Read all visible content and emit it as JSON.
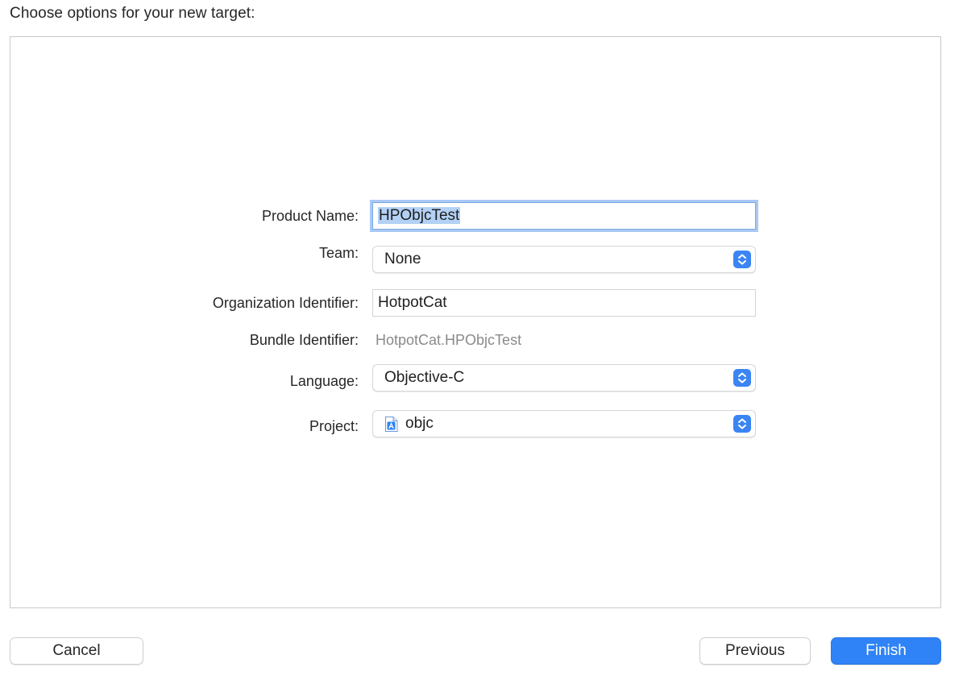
{
  "header": {
    "title": "Choose options for your new target:"
  },
  "form": {
    "product_name": {
      "label": "Product Name:",
      "value": "HPObjcTest"
    },
    "team": {
      "label": "Team:",
      "value": "None"
    },
    "organization_identifier": {
      "label": "Organization Identifier:",
      "value": "HotpotCat"
    },
    "bundle_identifier": {
      "label": "Bundle Identifier:",
      "value": "HotpotCat.HPObjcTest"
    },
    "language": {
      "label": "Language:",
      "value": "Objective-C"
    },
    "project": {
      "label": "Project:",
      "value": "objc",
      "icon": "xcode-project-icon"
    }
  },
  "footer": {
    "cancel_label": "Cancel",
    "previous_label": "Previous",
    "finish_label": "Finish"
  },
  "colors": {
    "accent": "#2f83f6",
    "focus_ring": "#a9c9f4",
    "selection": "#b3d1f5",
    "secondary_text": "#8a8a8a"
  }
}
